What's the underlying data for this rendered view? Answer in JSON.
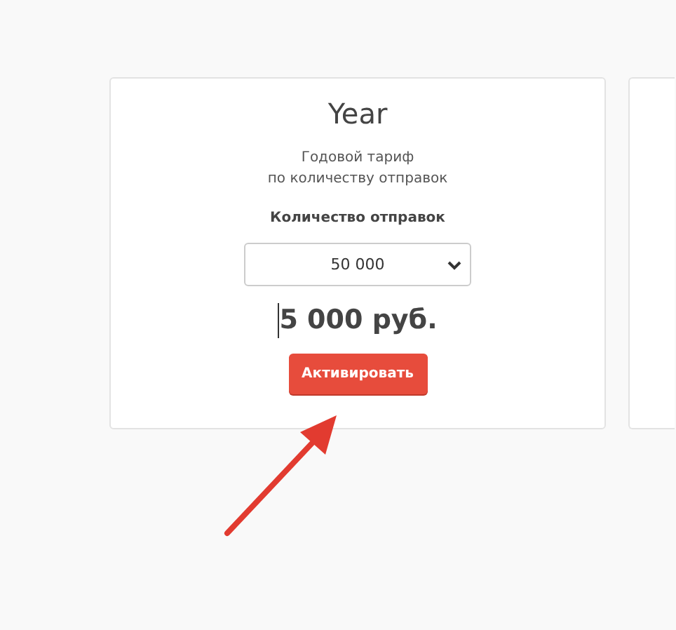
{
  "plans": [
    {
      "title": "Year",
      "description": [
        "Годовой тариф",
        "по количеству отправок"
      ],
      "select_label": "Количество отправок",
      "select_value": "50 000",
      "price": "5 000 руб.",
      "text_cursor": true,
      "button": "Активировать"
    }
  ],
  "next_card": {
    "kind": "card"
  }
}
